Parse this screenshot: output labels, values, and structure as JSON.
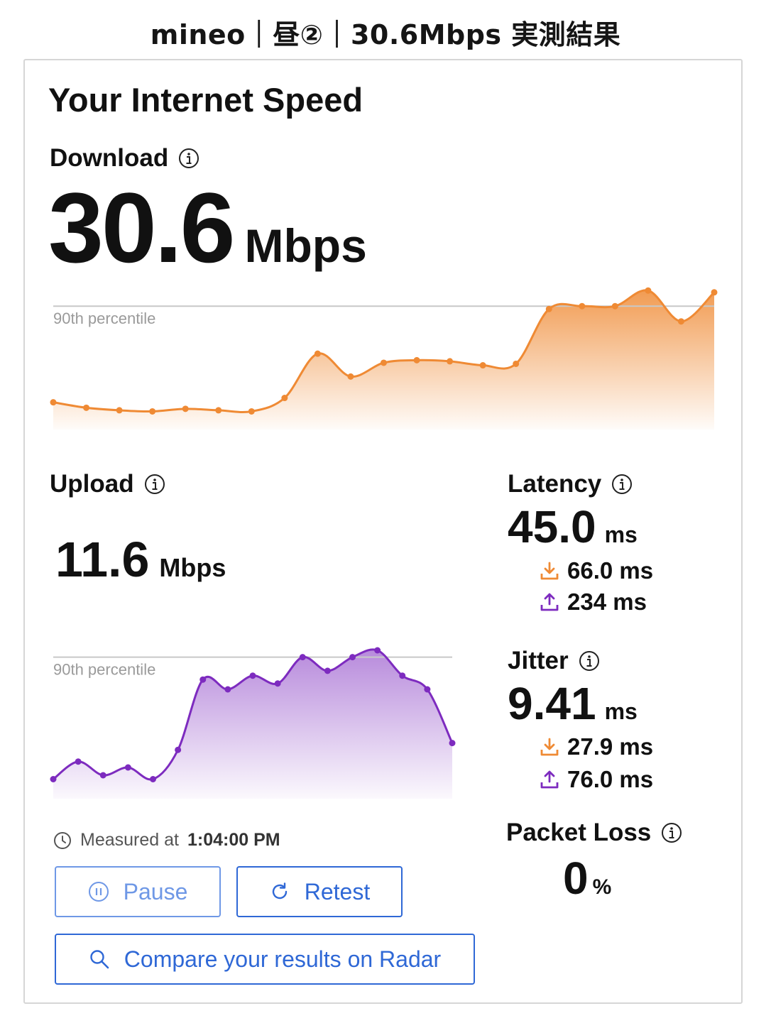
{
  "page_title": "mineo｜昼②｜30.6Mbps 実測結果",
  "card": {
    "title": "Your Internet Speed",
    "percentile_label": "90th percentile"
  },
  "download": {
    "label": "Download",
    "value": "30.6",
    "unit": "Mbps",
    "color": "#ef8a34",
    "chart_data": {
      "type": "area",
      "title": "",
      "xlabel": "",
      "ylabel": "",
      "ylim": [
        0,
        45
      ],
      "percentile_90": 34,
      "series": [
        {
          "name": "",
          "values": [
            7.5,
            6.0,
            5.3,
            5.0,
            5.7,
            5.3,
            5.0,
            8.7,
            20.9,
            14.6,
            18.4,
            19.1,
            18.8,
            17.7,
            18.1,
            33.2,
            34.0,
            34.0,
            38.3,
            29.8,
            37.8
          ]
        }
      ]
    }
  },
  "upload": {
    "label": "Upload",
    "value": "11.6",
    "unit": "Mbps",
    "color": "#7d2bbf",
    "chart_data": {
      "type": "area",
      "title": "",
      "xlabel": "",
      "ylabel": "",
      "ylim": [
        0,
        16
      ],
      "percentile_90": 14.5,
      "series": [
        {
          "name": "",
          "values": [
            2.0,
            3.8,
            2.4,
            3.2,
            2.0,
            5.0,
            12.2,
            11.2,
            12.6,
            11.8,
            14.5,
            13.1,
            14.5,
            15.2,
            12.6,
            11.2,
            5.7
          ]
        }
      ]
    }
  },
  "latency": {
    "label": "Latency",
    "value": "45.0",
    "unit": "ms",
    "download_value": "66.0 ms",
    "upload_value": "234 ms"
  },
  "jitter": {
    "label": "Jitter",
    "value": "9.41",
    "unit": "ms",
    "download_value": "27.9 ms",
    "upload_value": "76.0 ms"
  },
  "packet_loss": {
    "label": "Packet Loss",
    "value": "0",
    "unit": "%"
  },
  "measured": {
    "prefix": "Measured at",
    "time": "1:04:00 PM"
  },
  "buttons": {
    "pause": "Pause",
    "retest": "Retest",
    "compare": "Compare your results on Radar"
  },
  "icons": [
    "info-icon",
    "clock-icon",
    "pause-icon",
    "refresh-icon",
    "search-icon",
    "download-arrow-icon",
    "upload-arrow-icon"
  ],
  "colors": {
    "accent_blue": "#2f68d6",
    "download_orange": "#ef8a34",
    "upload_purple": "#7d2bbf"
  }
}
